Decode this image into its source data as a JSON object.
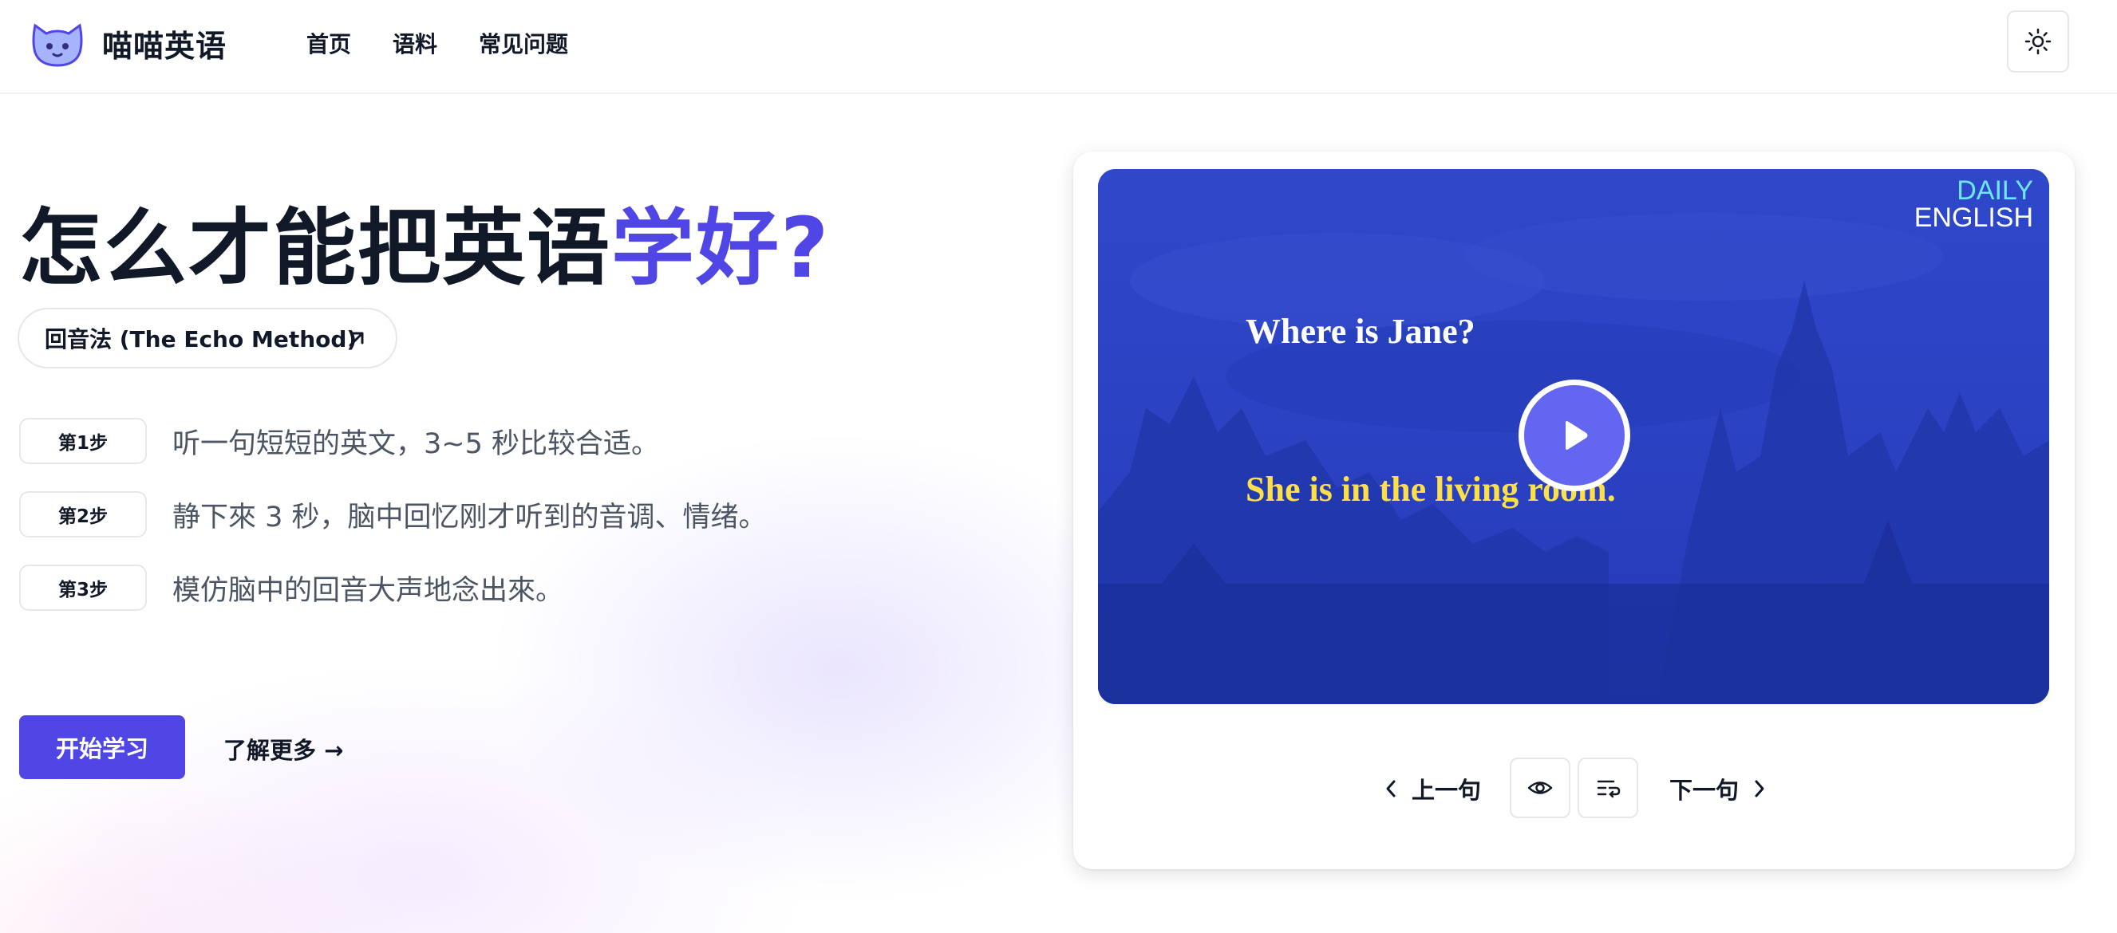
{
  "header": {
    "app_name": "喵喵英语",
    "nav": [
      "首页",
      "语料",
      "常见问题"
    ],
    "theme_icon": "sun-icon"
  },
  "hero": {
    "headline_main": "怎么才能把英语",
    "headline_accent": "学好?",
    "method_pill": "回音法 (The Echo Method)",
    "steps": [
      {
        "badge": "第1步",
        "text": "听一句短短的英文，3~5 秒比较合适。"
      },
      {
        "badge": "第2步",
        "text": "静下來 3 秒，脑中回忆刚才听到的音调、情绪。"
      },
      {
        "badge": "第3步",
        "text": "模仿脑中的回音大声地念出來。"
      }
    ],
    "primary_button": "开始学习",
    "learn_more": "了解更多 →"
  },
  "player": {
    "brand_top": "DAILY",
    "brand_bottom": "ENGLISH",
    "subtitle_english": "Where is Jane?",
    "subtitle_answer": "She is in the living room.",
    "prev_label": "上一句",
    "next_label": "下一句",
    "icons": [
      "chevron-left-icon",
      "eye-icon",
      "list-repeat-icon",
      "chevron-right-icon",
      "play-icon"
    ]
  },
  "colors": {
    "accent": "#4f46e5",
    "video_tint": "#2943c8",
    "subtitle_highlight": "#fde047"
  }
}
